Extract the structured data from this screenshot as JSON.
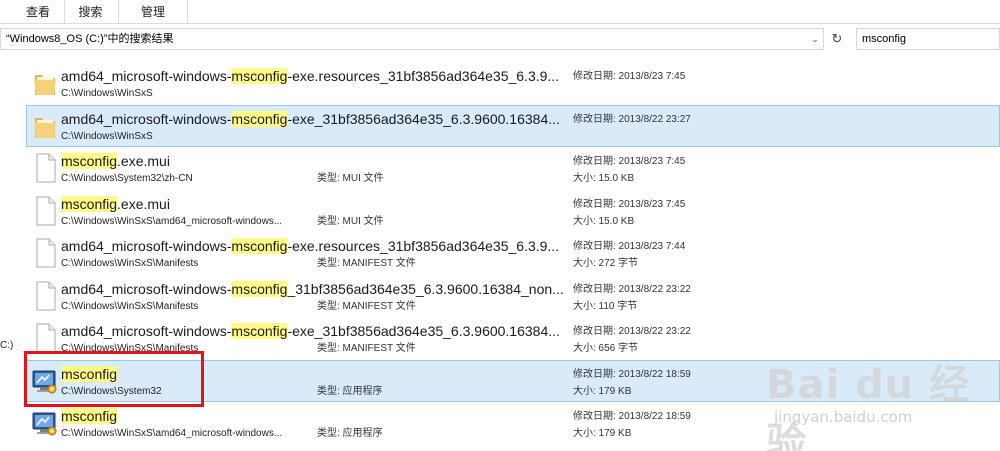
{
  "ribbon": {
    "tabs": [
      {
        "label": "查看"
      },
      {
        "label": "搜索"
      },
      {
        "label": "管理"
      }
    ]
  },
  "address_bar": {
    "text": "“Windows8_OS (C:)”中的搜索结果",
    "dropdown_glyph": "⌄",
    "refresh_glyph": "↻"
  },
  "search_box": {
    "value": "msconfig"
  },
  "left_edge_text": "C:)",
  "results": [
    {
      "icon": "folder-icon",
      "name_pre": "amd64_microsoft-windows-",
      "name_hl": "msconfig",
      "name_post": "-exe.resources_31bf3856ad364e35_6.3.9...",
      "path": "C:\\Windows\\WinSxS",
      "type": "",
      "date": "修改日期: 2013/8/23 7:45",
      "size": "",
      "selected": false
    },
    {
      "icon": "folder-icon",
      "name_pre": "amd64_microsoft-windows-",
      "name_hl": "msconfig",
      "name_post": "-exe_31bf3856ad364e35_6.3.9600.16384...",
      "path": "C:\\Windows\\WinSxS",
      "type": "",
      "date": "修改日期: 2013/8/22 23:27",
      "size": "",
      "selected": true
    },
    {
      "icon": "file-icon",
      "name_pre": "",
      "name_hl": "msconfig",
      "name_post": ".exe.mui",
      "path": "C:\\Windows\\System32\\zh-CN",
      "type": "类型: MUI 文件",
      "date": "修改日期: 2013/8/23 7:45",
      "size": "大小: 15.0 KB",
      "selected": false
    },
    {
      "icon": "file-icon",
      "name_pre": "",
      "name_hl": "msconfig",
      "name_post": ".exe.mui",
      "path": "C:\\Windows\\WinSxS\\amd64_microsoft-windows...",
      "type": "类型: MUI 文件",
      "date": "修改日期: 2013/8/23 7:45",
      "size": "大小: 15.0 KB",
      "selected": false
    },
    {
      "icon": "file-icon",
      "name_pre": "amd64_microsoft-windows-",
      "name_hl": "msconfig",
      "name_post": "-exe.resources_31bf3856ad364e35_6.3.9...",
      "path": "C:\\Windows\\WinSxS\\Manifests",
      "type": "类型: MANIFEST 文件",
      "date": "修改日期: 2013/8/23 7:44",
      "size": "大小: 272 字节",
      "selected": false
    },
    {
      "icon": "file-icon",
      "name_pre": "amd64_microsoft-windows-",
      "name_hl": "msconfig",
      "name_post": "_31bf3856ad364e35_6.3.9600.16384_non...",
      "path": "C:\\Windows\\WinSxS\\Manifests",
      "type": "类型: MANIFEST 文件",
      "date": "修改日期: 2013/8/22 23:22",
      "size": "大小: 110 字节",
      "selected": false
    },
    {
      "icon": "file-icon",
      "name_pre": "amd64_microsoft-windows-",
      "name_hl": "msconfig",
      "name_post": "-exe_31bf3856ad364e35_6.3.9600.16384...",
      "path": "C:\\Windows\\WinSxS\\Manifests",
      "type": "类型: MANIFEST 文件",
      "date": "修改日期: 2013/8/22 23:22",
      "size": "大小: 656 字节",
      "selected": false
    },
    {
      "icon": "msconfig-app-icon",
      "name_pre": "",
      "name_hl": "msconfig",
      "name_post": "",
      "path": "C:\\Windows\\System32",
      "type": "类型: 应用程序",
      "date": "修改日期: 2013/8/22 18:59",
      "size": "大小: 179 KB",
      "selected": true
    },
    {
      "icon": "msconfig-app-icon",
      "name_pre": "",
      "name_hl": "msconfig",
      "name_post": "",
      "path": "C:\\Windows\\WinSxS\\amd64_microsoft-windows...",
      "type": "类型: 应用程序",
      "date": "修改日期: 2013/8/22 18:59",
      "size": "大小: 179 KB",
      "selected": false
    }
  ],
  "colors": {
    "highlight": "#fffb86",
    "selection": "#d9ebf9",
    "annotation_red": "#e0151a"
  },
  "watermark": {
    "main": "Bai du 经验",
    "sub": "jingyan.baidu.com"
  }
}
